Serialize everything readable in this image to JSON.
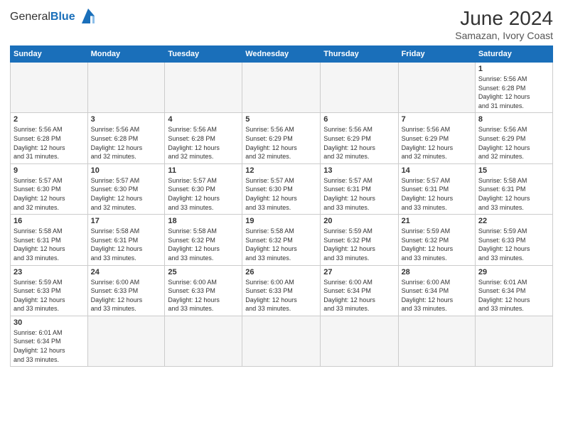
{
  "header": {
    "logo_text_general": "General",
    "logo_text_blue": "Blue",
    "month": "June 2024",
    "location": "Samazan, Ivory Coast"
  },
  "weekdays": [
    "Sunday",
    "Monday",
    "Tuesday",
    "Wednesday",
    "Thursday",
    "Friday",
    "Saturday"
  ],
  "weeks": [
    [
      {
        "day": "",
        "empty": true
      },
      {
        "day": "",
        "empty": true
      },
      {
        "day": "",
        "empty": true
      },
      {
        "day": "",
        "empty": true
      },
      {
        "day": "",
        "empty": true
      },
      {
        "day": "",
        "empty": true
      },
      {
        "day": "1",
        "sunrise": "5:56 AM",
        "sunset": "6:28 PM",
        "daylight": "12 hours and 31 minutes."
      }
    ],
    [
      {
        "day": "2",
        "sunrise": "5:56 AM",
        "sunset": "6:28 PM",
        "daylight": "12 hours and 31 minutes."
      },
      {
        "day": "3",
        "sunrise": "5:56 AM",
        "sunset": "6:28 PM",
        "daylight": "12 hours and 32 minutes."
      },
      {
        "day": "4",
        "sunrise": "5:56 AM",
        "sunset": "6:28 PM",
        "daylight": "12 hours and 32 minutes."
      },
      {
        "day": "5",
        "sunrise": "5:56 AM",
        "sunset": "6:29 PM",
        "daylight": "12 hours and 32 minutes."
      },
      {
        "day": "6",
        "sunrise": "5:56 AM",
        "sunset": "6:29 PM",
        "daylight": "12 hours and 32 minutes."
      },
      {
        "day": "7",
        "sunrise": "5:56 AM",
        "sunset": "6:29 PM",
        "daylight": "12 hours and 32 minutes."
      },
      {
        "day": "8",
        "sunrise": "5:56 AM",
        "sunset": "6:29 PM",
        "daylight": "12 hours and 32 minutes."
      }
    ],
    [
      {
        "day": "9",
        "sunrise": "5:57 AM",
        "sunset": "6:30 PM",
        "daylight": "12 hours and 32 minutes."
      },
      {
        "day": "10",
        "sunrise": "5:57 AM",
        "sunset": "6:30 PM",
        "daylight": "12 hours and 32 minutes."
      },
      {
        "day": "11",
        "sunrise": "5:57 AM",
        "sunset": "6:30 PM",
        "daylight": "12 hours and 33 minutes."
      },
      {
        "day": "12",
        "sunrise": "5:57 AM",
        "sunset": "6:30 PM",
        "daylight": "12 hours and 33 minutes."
      },
      {
        "day": "13",
        "sunrise": "5:57 AM",
        "sunset": "6:31 PM",
        "daylight": "12 hours and 33 minutes."
      },
      {
        "day": "14",
        "sunrise": "5:57 AM",
        "sunset": "6:31 PM",
        "daylight": "12 hours and 33 minutes."
      },
      {
        "day": "15",
        "sunrise": "5:58 AM",
        "sunset": "6:31 PM",
        "daylight": "12 hours and 33 minutes."
      }
    ],
    [
      {
        "day": "16",
        "sunrise": "5:58 AM",
        "sunset": "6:31 PM",
        "daylight": "12 hours and 33 minutes."
      },
      {
        "day": "17",
        "sunrise": "5:58 AM",
        "sunset": "6:31 PM",
        "daylight": "12 hours and 33 minutes."
      },
      {
        "day": "18",
        "sunrise": "5:58 AM",
        "sunset": "6:32 PM",
        "daylight": "12 hours and 33 minutes."
      },
      {
        "day": "19",
        "sunrise": "5:58 AM",
        "sunset": "6:32 PM",
        "daylight": "12 hours and 33 minutes."
      },
      {
        "day": "20",
        "sunrise": "5:59 AM",
        "sunset": "6:32 PM",
        "daylight": "12 hours and 33 minutes."
      },
      {
        "day": "21",
        "sunrise": "5:59 AM",
        "sunset": "6:32 PM",
        "daylight": "12 hours and 33 minutes."
      },
      {
        "day": "22",
        "sunrise": "5:59 AM",
        "sunset": "6:33 PM",
        "daylight": "12 hours and 33 minutes."
      }
    ],
    [
      {
        "day": "23",
        "sunrise": "5:59 AM",
        "sunset": "6:33 PM",
        "daylight": "12 hours and 33 minutes."
      },
      {
        "day": "24",
        "sunrise": "6:00 AM",
        "sunset": "6:33 PM",
        "daylight": "12 hours and 33 minutes."
      },
      {
        "day": "25",
        "sunrise": "6:00 AM",
        "sunset": "6:33 PM",
        "daylight": "12 hours and 33 minutes."
      },
      {
        "day": "26",
        "sunrise": "6:00 AM",
        "sunset": "6:33 PM",
        "daylight": "12 hours and 33 minutes."
      },
      {
        "day": "27",
        "sunrise": "6:00 AM",
        "sunset": "6:34 PM",
        "daylight": "12 hours and 33 minutes."
      },
      {
        "day": "28",
        "sunrise": "6:00 AM",
        "sunset": "6:34 PM",
        "daylight": "12 hours and 33 minutes."
      },
      {
        "day": "29",
        "sunrise": "6:01 AM",
        "sunset": "6:34 PM",
        "daylight": "12 hours and 33 minutes."
      }
    ],
    [
      {
        "day": "30",
        "sunrise": "6:01 AM",
        "sunset": "6:34 PM",
        "daylight": "12 hours and 33 minutes."
      },
      {
        "day": "",
        "empty": true
      },
      {
        "day": "",
        "empty": true
      },
      {
        "day": "",
        "empty": true
      },
      {
        "day": "",
        "empty": true
      },
      {
        "day": "",
        "empty": true
      },
      {
        "day": "",
        "empty": true
      }
    ]
  ],
  "labels": {
    "sunrise": "Sunrise:",
    "sunset": "Sunset:",
    "daylight": "Daylight:"
  }
}
